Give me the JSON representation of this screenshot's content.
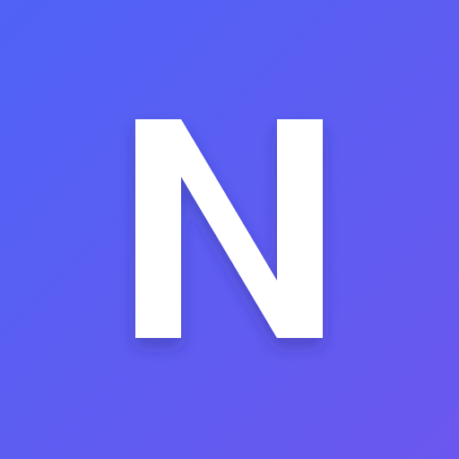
{
  "icon": {
    "letter": "N",
    "background_gradient": [
      "#4f63f5",
      "#6b57ef"
    ],
    "letter_color": "#ffffff"
  }
}
